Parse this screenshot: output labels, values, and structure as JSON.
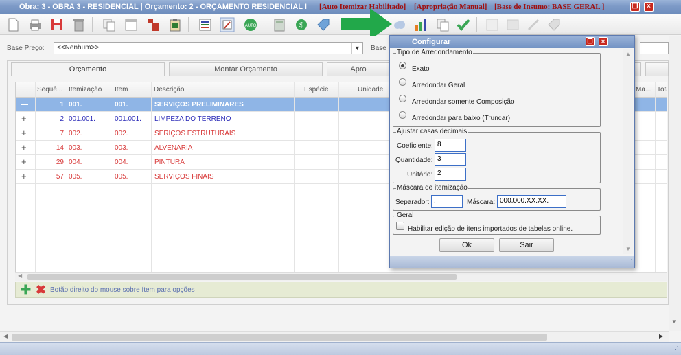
{
  "window": {
    "title": "Obra: 3 - OBRA 3 - RESIDENCIAL | Orçamento: 2 - ORÇAMENTO RESIDENCIAL I",
    "flags": [
      "[Auto Itemizar Habilitado]",
      "[Apropriação Manual]",
      "[Base de Insumo: BASE GERAL ]"
    ],
    "restore_label": "❐",
    "close_label": "×"
  },
  "filter": {
    "base_preco_label": "Base Preço:",
    "base_preco_value": "<<Nenhum>>",
    "base_label_partial": "Base I"
  },
  "tabs": [
    {
      "label": "Orçamento",
      "active": true
    },
    {
      "label": "Montar Orçamento",
      "active": false
    },
    {
      "label": "Apro",
      "active": false
    }
  ],
  "grid": {
    "columns": [
      "Sequê...",
      "Itemização",
      "Item",
      "Descrição",
      "Espécie",
      "Unidade",
      "Ma...",
      "Tota"
    ],
    "rows": [
      {
        "exp": "—",
        "seq": "1",
        "itemizacao": "001.",
        "item": "001.",
        "descricao": "SERVIÇOS PRELIMINARES",
        "color": "#ffffff",
        "selected": true
      },
      {
        "exp": "+",
        "seq": "2",
        "itemizacao": "001.001.",
        "item": "001.001.",
        "descricao": "LIMPEZA DO TERRENO",
        "color": "#2d2db8",
        "selected": false
      },
      {
        "exp": "+",
        "seq": "7",
        "itemizacao": "002.",
        "item": "002.",
        "descricao": "SERIÇOS ESTRUTURAIS",
        "color": "#d83a3a",
        "selected": false
      },
      {
        "exp": "+",
        "seq": "14",
        "itemizacao": "003.",
        "item": "003.",
        "descricao": "ALVENARIA",
        "color": "#d83a3a",
        "selected": false
      },
      {
        "exp": "+",
        "seq": "29",
        "itemizacao": "004.",
        "item": "004.",
        "descricao": "PINTURA",
        "color": "#d83a3a",
        "selected": false
      },
      {
        "exp": "+",
        "seq": "57",
        "itemizacao": "005.",
        "item": "005.",
        "descricao": "SERVIÇOS FINAIS",
        "color": "#d83a3a",
        "selected": false
      }
    ]
  },
  "bottombar": {
    "hint": "Botão direito do mouse sobre ítem para opções"
  },
  "dialog": {
    "title": "Configurar",
    "arredondamento": {
      "legend": "Tipo de Arredondamento",
      "options": [
        {
          "label": "Exato",
          "checked": true
        },
        {
          "label": "Arredondar Geral",
          "checked": false
        },
        {
          "label": "Arredondar somente Composição",
          "checked": false
        },
        {
          "label": "Arredondar para baixo (Truncar)",
          "checked": false
        }
      ]
    },
    "casas": {
      "legend": "Ajustar casas decimais",
      "coeficiente_label": "Coeficiente:",
      "coeficiente_value": "8",
      "quantidade_label": "Quantidade:",
      "quantidade_value": "3",
      "unitario_label": "Unitário:",
      "unitario_value": "2"
    },
    "mascara": {
      "legend": "Máscara de itemização",
      "separador_label": "Separador:",
      "separador_value": ".",
      "mascara_label": "Máscara:",
      "mascara_value": "000.000.XX.XX."
    },
    "geral": {
      "legend": "Geral",
      "checkbox_label": "Habilitar edição de itens importados de tabelas online.",
      "checked": false
    },
    "ok_label": "Ok",
    "sair_label": "Sair"
  },
  "colors": {
    "accent": "#7d9ac7",
    "selected_row": "#8fb5e6",
    "arrow": "#22a84a"
  }
}
